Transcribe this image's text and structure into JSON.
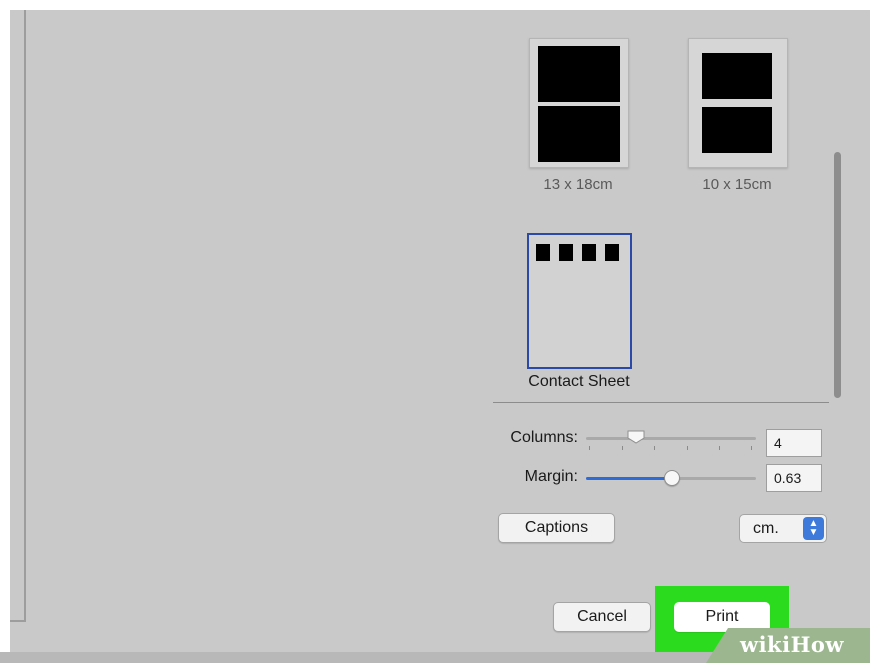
{
  "layouts": {
    "items": [
      {
        "label": "13 x 18cm"
      },
      {
        "label": "10 x 15cm"
      },
      {
        "label": "Contact Sheet",
        "selected": true
      }
    ]
  },
  "settings": {
    "columns": {
      "label": "Columns:",
      "value": "4"
    },
    "margin": {
      "label": "Margin:",
      "value": "0.63"
    },
    "captions_label": "Captions",
    "units": {
      "selected": "cm."
    }
  },
  "actions": {
    "cancel_label": "Cancel",
    "print_label": "Print"
  },
  "watermark": {
    "text": "wikiHow"
  },
  "colors": {
    "accent": "#2f6bd6",
    "selection_border": "#2a49a8",
    "highlight": "#2bdc1e",
    "dialog_bg": "#c9c9c9"
  },
  "icons": {
    "units_arrows": "chevron-up-down-icon"
  }
}
